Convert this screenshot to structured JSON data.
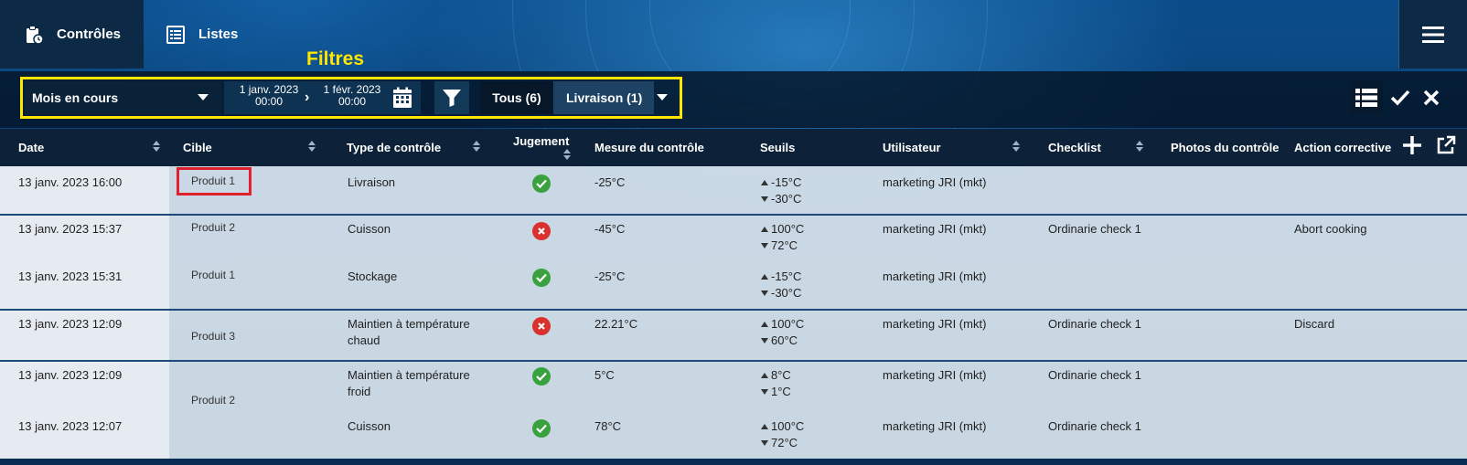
{
  "nav": {
    "tabs": [
      {
        "label": "Contrôles",
        "icon": "clipboard-icon",
        "active": true
      },
      {
        "label": "Listes",
        "icon": "list-icon",
        "active": false
      }
    ],
    "menu_icon": "hamburger-icon"
  },
  "filters": {
    "annotation": "Filtres",
    "period": "Mois en cours",
    "date_start_day": "1 janv. 2023",
    "date_start_time": "00:00",
    "date_end_day": "1 févr. 2023",
    "date_end_time": "00:00",
    "segment_all": "Tous (6)",
    "segment_delivery": "Livraison (1)"
  },
  "table": {
    "headers": [
      "Date",
      "Cible",
      "Type de contrôle",
      "Jugement",
      "Mesure du contrôle",
      "Seuils",
      "Utilisateur",
      "Checklist",
      "Photos du contrôle",
      "Action corrective"
    ],
    "rows": [
      {
        "date": "13 janv. 2023 16:00",
        "cible": "Produit 1",
        "type": "Livraison",
        "jugement": "ok",
        "mesure": "-25°C",
        "seuil_haut": "-15°C",
        "seuil_bas": "-30°C",
        "utilisateur": "marketing JRI (mkt)",
        "checklist": "",
        "action": ""
      },
      {
        "date": "13 janv. 2023 15:37",
        "cible": "Produit 2",
        "type": "Cuisson",
        "jugement": "ko",
        "mesure": "-45°C",
        "seuil_haut": "100°C",
        "seuil_bas": "72°C",
        "utilisateur": "marketing JRI (mkt)",
        "checklist": "Ordinarie check 1",
        "action": "Abort cooking"
      },
      {
        "date": "13 janv. 2023 15:31",
        "cible": "Produit 1",
        "type": "Stockage",
        "jugement": "ok",
        "mesure": "-25°C",
        "seuil_haut": "-15°C",
        "seuil_bas": "-30°C",
        "utilisateur": "marketing JRI (mkt)",
        "checklist": "",
        "action": ""
      },
      {
        "date": "13 janv. 2023 12:09",
        "cible": "Produit 3",
        "type_line1": "Maintien à température",
        "type_line2": "chaud",
        "jugement": "ko",
        "mesure": "22.21°C",
        "seuil_haut": "100°C",
        "seuil_bas": "60°C",
        "utilisateur": "marketing JRI (mkt)",
        "checklist": "Ordinarie check 1",
        "action": "Discard"
      },
      {
        "date": "13 janv. 2023 12:09",
        "cible": "Produit 2",
        "type_line1": "Maintien à température",
        "type_line2": "froid",
        "jugement": "ok",
        "mesure": "5°C",
        "seuil_haut": "8°C",
        "seuil_bas": "1°C",
        "utilisateur": "marketing JRI (mkt)",
        "checklist": "Ordinarie check 1",
        "action": ""
      },
      {
        "date": "13 janv. 2023 12:07",
        "cible": "",
        "type": "Cuisson",
        "jugement": "ok",
        "mesure": "78°C",
        "seuil_haut": "100°C",
        "seuil_bas": "72°C",
        "utilisateur": "marketing JRI (mkt)",
        "checklist": "Ordinarie check 1",
        "action": ""
      }
    ]
  },
  "colors": {
    "ok": "#3aa13f",
    "ko": "#d9312d",
    "annotation": "#ffe600",
    "highlight": "#e0202a"
  }
}
